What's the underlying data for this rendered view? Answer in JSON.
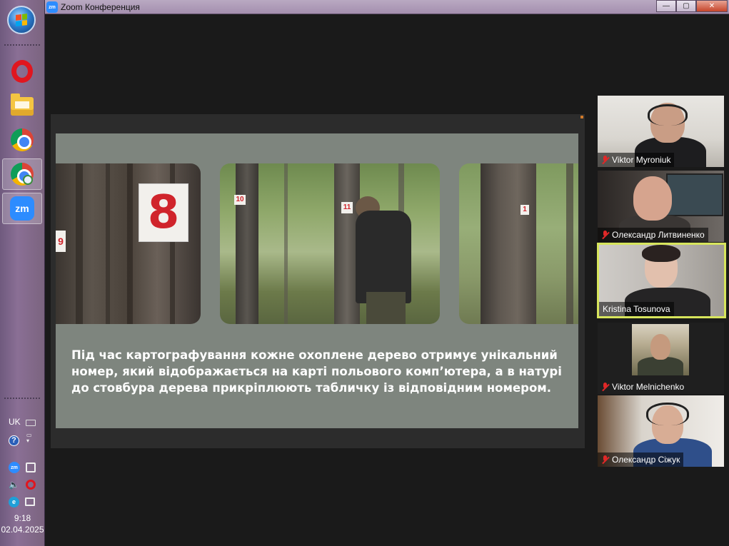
{
  "window": {
    "title": "Zoom Конференция",
    "icon_label": "zm",
    "minimize_glyph": "—",
    "maximize_glyph": "▢",
    "close_glyph": "✕"
  },
  "taskbar": {
    "apps": [
      {
        "name": "Opera",
        "icon": "opera-icon"
      },
      {
        "name": "Windows Explorer",
        "icon": "folder-icon"
      },
      {
        "name": "Google Chrome",
        "icon": "chrome-icon"
      },
      {
        "name": "Google Chrome (profile)",
        "icon": "chrome-icon"
      },
      {
        "name": "Zoom",
        "icon": "zoom-icon",
        "label": "zm"
      }
    ],
    "tray": {
      "language": "UK",
      "time": "9:18",
      "date": "02.04.2025",
      "help_glyph": "?",
      "zoom_label": "zm",
      "e_label": "e"
    }
  },
  "shared_screen": {
    "photo1": {
      "tag_main": "8",
      "tag_edge": "9"
    },
    "photo2": {
      "tag_left": "10",
      "tag_right": "11"
    },
    "photo3": {
      "tag": "1"
    },
    "caption": "Під час картографування кожне охоплене дерево отримує унікальний номер, який відображається на карті польового комп’ютера, а в натурі до стовбура дерева прикріплюють табличку із відповідним номером."
  },
  "participants": [
    {
      "name": "Viktor Myroniuk",
      "muted": true,
      "active_speaker": false
    },
    {
      "name": "Олександр Литвиненко",
      "muted": true,
      "active_speaker": false
    },
    {
      "name": "Kristina Tosunova",
      "muted": false,
      "active_speaker": true
    },
    {
      "name": "Viktor Melnichenko",
      "muted": true,
      "active_speaker": false
    },
    {
      "name": "Олександр Сіжук",
      "muted": true,
      "active_speaker": false
    }
  ],
  "colors": {
    "zoom_blue": "#2d8cff",
    "active_speaker_border": "#d7e55c",
    "muted_red": "#e02828",
    "slide_background": "#7e857e"
  }
}
